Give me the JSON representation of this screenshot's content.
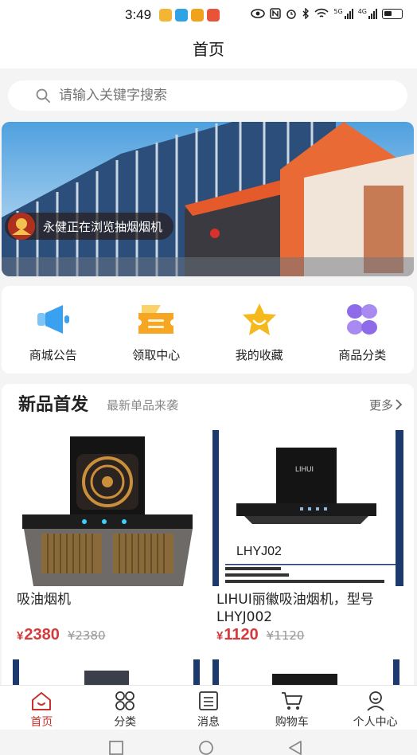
{
  "status_bar": {
    "time": "3:49",
    "network_5g": "5G",
    "network_4g": "4G"
  },
  "nav": {
    "title": "首页"
  },
  "search": {
    "placeholder": "请输入关键字搜索",
    "value": ""
  },
  "banner": {
    "toast_text": "永健正在浏览抽烟烟机"
  },
  "quick_menu": [
    {
      "label": "商城公告",
      "icon": "megaphone-icon",
      "color": "#3aa0f0"
    },
    {
      "label": "领取中心",
      "icon": "ticket-icon",
      "color": "#f5a623"
    },
    {
      "label": "我的收藏",
      "icon": "star-icon",
      "color": "#f5b81d"
    },
    {
      "label": "商品分类",
      "icon": "category-icon",
      "color": "#8e6be8"
    }
  ],
  "new_products": {
    "title": "新品首发",
    "subtitle": "最新单品来袭",
    "more": "更多",
    "items": [
      {
        "name": "吸油烟机",
        "price": "2380",
        "old_price": "¥2380",
        "currency": "¥"
      },
      {
        "name": "LIHUI丽徽吸油烟机，型号LHYJ002",
        "price": "1120",
        "old_price": "¥1120",
        "currency": "¥",
        "image_model": "LHYJ02",
        "image_brand": "LIHUI"
      }
    ]
  },
  "tab_bar": [
    {
      "label": "首页",
      "icon": "home-icon",
      "active": true
    },
    {
      "label": "分类",
      "icon": "grid-icon",
      "active": false
    },
    {
      "label": "消息",
      "icon": "message-icon",
      "active": false
    },
    {
      "label": "购物车",
      "icon": "cart-icon",
      "active": false
    },
    {
      "label": "个人中心",
      "icon": "profile-icon",
      "active": false
    }
  ],
  "colors": {
    "accent": "#c8322e",
    "price": "#d63a3a"
  }
}
